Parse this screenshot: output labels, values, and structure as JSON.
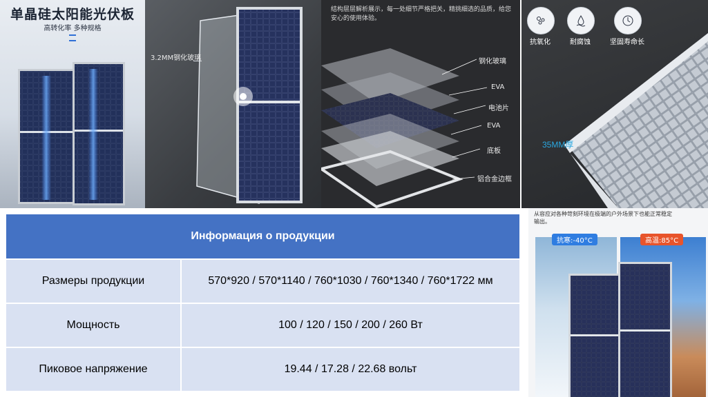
{
  "panel1": {
    "title": "单晶硅太阳能光伏板",
    "subtitle": "高转化率  多种规格"
  },
  "panel2": {
    "glass_label": "3.2MM钢化玻璃"
  },
  "panel3": {
    "description": "结构层层解析展示，每一处细节严格把关，精挑细选的品质，给您安心的使用体验。",
    "layers": [
      "钢化玻璃",
      "EVA",
      "电池片",
      "EVA",
      "底板",
      "铝合金边框"
    ]
  },
  "panel4": {
    "features": [
      "抗氧化",
      "耐腐蚀",
      "坚固寿命长"
    ],
    "frame_label": "35MM厚"
  },
  "panel5": {
    "description": "从容应对各种苛刻环境在极端的户外场景下也能正常稳定输出。",
    "cold_badge": "抗寒:-40°C",
    "hot_badge": "高温:85°C"
  },
  "table": {
    "header": "Информация о продукции",
    "rows": [
      {
        "label": "Размеры продукции",
        "value": "570*920 / 570*1140 / 760*1030 / 760*1340 / 760*1722  мм"
      },
      {
        "label": "Мощность",
        "value": "100 / 120 / 150 / 200 / 260 Вт"
      },
      {
        "label": "Пиковое напряжение",
        "value": "19.44 / 17.28 / 22.68  вольт"
      }
    ]
  },
  "colors": {
    "table_header": "#4472c4",
    "table_cell": "#d9e1f2",
    "badge_cold": "#2f7de1",
    "badge_hot": "#e8542b"
  }
}
